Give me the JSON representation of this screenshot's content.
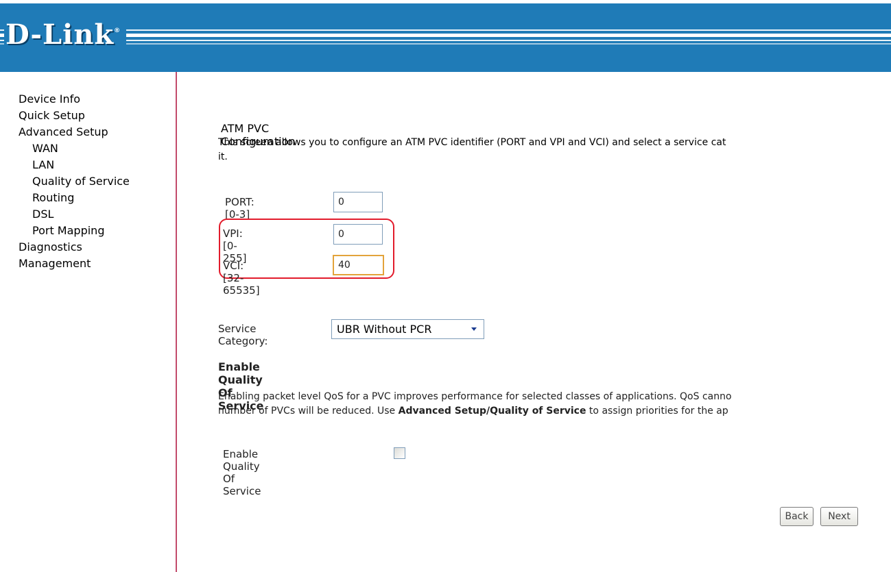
{
  "brand": {
    "logo_text": "D-Link",
    "logo_mark": "®",
    "header_color": "#1f7bb7"
  },
  "sidebar": {
    "items": [
      {
        "label": "Device Info"
      },
      {
        "label": "Quick Setup"
      },
      {
        "label": "Advanced Setup"
      },
      {
        "label": "WAN"
      },
      {
        "label": "LAN"
      },
      {
        "label": "Quality of Service"
      },
      {
        "label": "Routing"
      },
      {
        "label": "DSL"
      },
      {
        "label": "Port Mapping"
      },
      {
        "label": "Diagnostics"
      },
      {
        "label": "Management"
      }
    ]
  },
  "main": {
    "title": "ATM PVC Configuration",
    "description_line1": "This screen allows you to configure an ATM PVC identifier (PORT and VPI and VCI) and select a service cat",
    "description_line2": "it.",
    "port": {
      "label": "PORT: [0-3]",
      "value": "0"
    },
    "vpi": {
      "label": "VPI: [0-255]",
      "value": "0"
    },
    "vci": {
      "label": "VCI: [32-65535]",
      "value": "40"
    },
    "service_category": {
      "label": "Service Category:",
      "selected": "UBR Without PCR"
    },
    "qos": {
      "heading": "Enable Quality Of Service",
      "para_line1": "Enabling packet level QoS for a PVC improves performance for selected classes of applications.  QoS canno",
      "para_line2_prefix": "number of PVCs will be reduced. Use ",
      "para_line2_bold": "Advanced Setup/Quality of Service",
      "para_line2_suffix": " to assign priorities for the ap",
      "checkbox_label": "Enable Quality Of Service",
      "checked": false
    },
    "buttons": {
      "back": "Back",
      "next": "Next"
    }
  },
  "colors": {
    "highlight": "#e21b2b",
    "focus": "#e3a33a",
    "sidebar_border": "#c24a6b"
  }
}
